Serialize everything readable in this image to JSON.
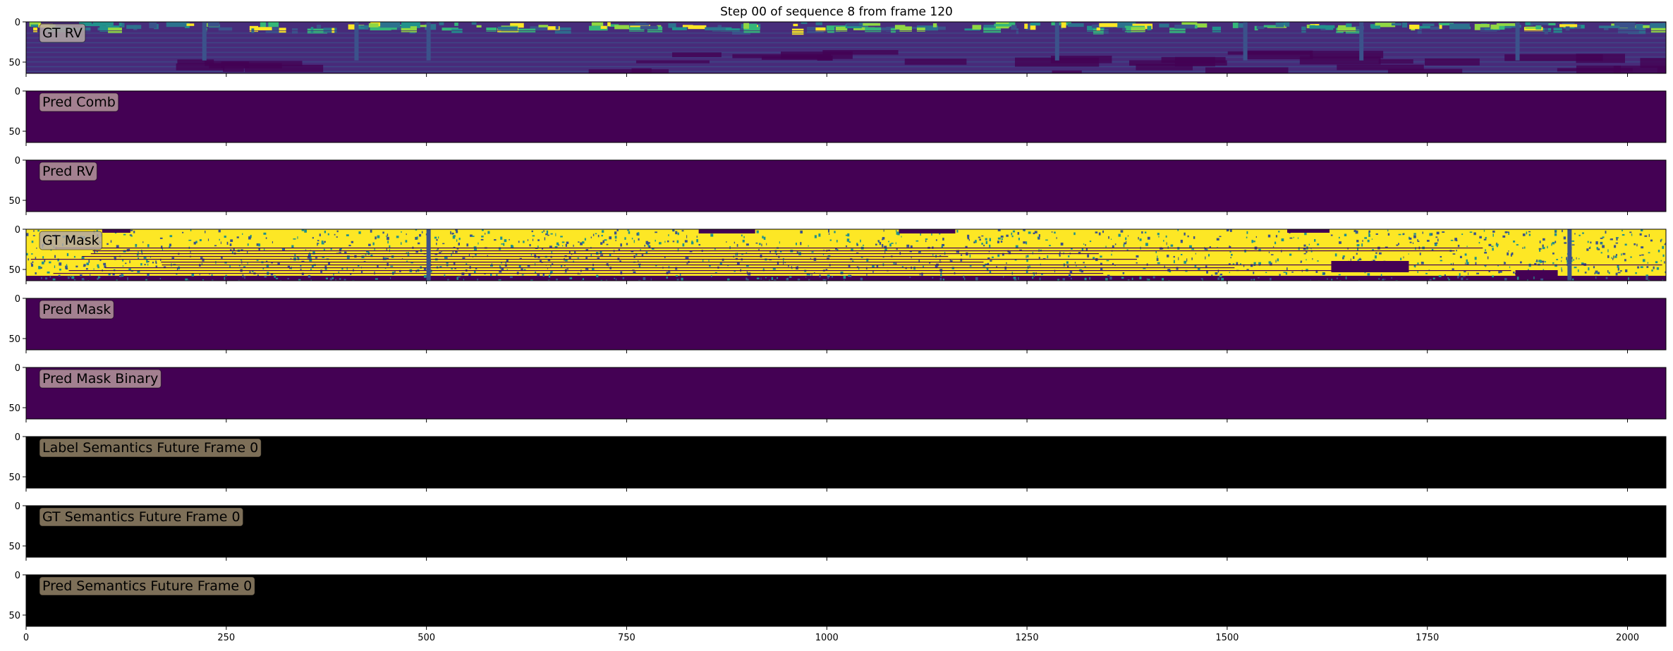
{
  "title": "Step 00 of sequence 8 from frame 120",
  "chart_data": {
    "type": "heatmap",
    "title": "Step 00 of sequence 8 from frame 120",
    "shared_x": true,
    "xlim": [
      0,
      2048
    ],
    "x_ticks": [
      0,
      250,
      500,
      750,
      1000,
      1250,
      1500,
      1750,
      2000
    ],
    "ylim": [
      0,
      64
    ],
    "y_ticks": [
      0,
      50
    ],
    "panels": [
      {
        "label": "GT RV",
        "content": "gt_rv",
        "colormap": "viridis"
      },
      {
        "label": "Pred Comb",
        "content": "uniform",
        "fill": "#440154",
        "box_color": "#a38090"
      },
      {
        "label": "Pred RV",
        "content": "uniform",
        "fill": "#440154",
        "box_color": "#a38090"
      },
      {
        "label": "GT Mask",
        "content": "gt_mask",
        "colormap": "viridis"
      },
      {
        "label": "Pred Mask",
        "content": "uniform",
        "fill": "#440154",
        "box_color": "#a38090"
      },
      {
        "label": "Pred Mask Binary",
        "content": "uniform",
        "fill": "#440154",
        "box_color": "#a38090"
      },
      {
        "label": "Label Semantics Future Frame 0",
        "content": "uniform",
        "fill": "#000000",
        "box_color": "#7d6f58"
      },
      {
        "label": "GT Semantics Future Frame 0",
        "content": "uniform",
        "fill": "#000000",
        "box_color": "#7d6f58"
      },
      {
        "label": "Pred Semantics Future Frame 0",
        "content": "uniform",
        "fill": "#000000",
        "box_color": "#7d6f58"
      }
    ]
  }
}
